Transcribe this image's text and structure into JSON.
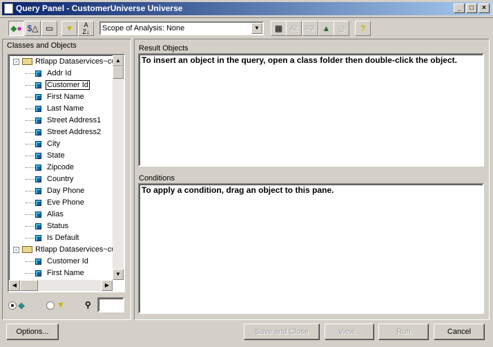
{
  "window": {
    "title": "Query Panel - CustomerUniverse Universe",
    "controls": [
      "_",
      "□",
      "×"
    ]
  },
  "toolbar": {
    "scope_value": "Scope of Analysis: None",
    "sql_label": "SQL",
    "help_icon": "?"
  },
  "left": {
    "heading": "Classes and Objects",
    "tree": [
      {
        "label": "Rtlapp Dataservices~cu",
        "type": "class",
        "items": [
          "Addr Id",
          "Customer Id",
          "First Name",
          "Last Name",
          "Street Address1",
          "Street Address2",
          "City",
          "State",
          "Zipcode",
          "Country",
          "Day Phone",
          "Eve Phone",
          "Alias",
          "Status",
          "Is Default"
        ]
      },
      {
        "label": "Rtlapp Dataservices~cu",
        "type": "class",
        "items": [
          "Customer Id",
          "First Name"
        ]
      }
    ],
    "selected_item": "Customer Id",
    "view_mode": "objects",
    "find_value": ""
  },
  "result": {
    "label": "Result Objects",
    "hint": "To insert an object in the query, open a class folder then double-click the object."
  },
  "conditions": {
    "label": "Conditions",
    "hint": "To apply a condition, drag an object to this pane."
  },
  "buttons": {
    "options": "Options...",
    "save_close": "Save and Close",
    "view": "View...",
    "run": "Run",
    "cancel": "Cancel"
  }
}
